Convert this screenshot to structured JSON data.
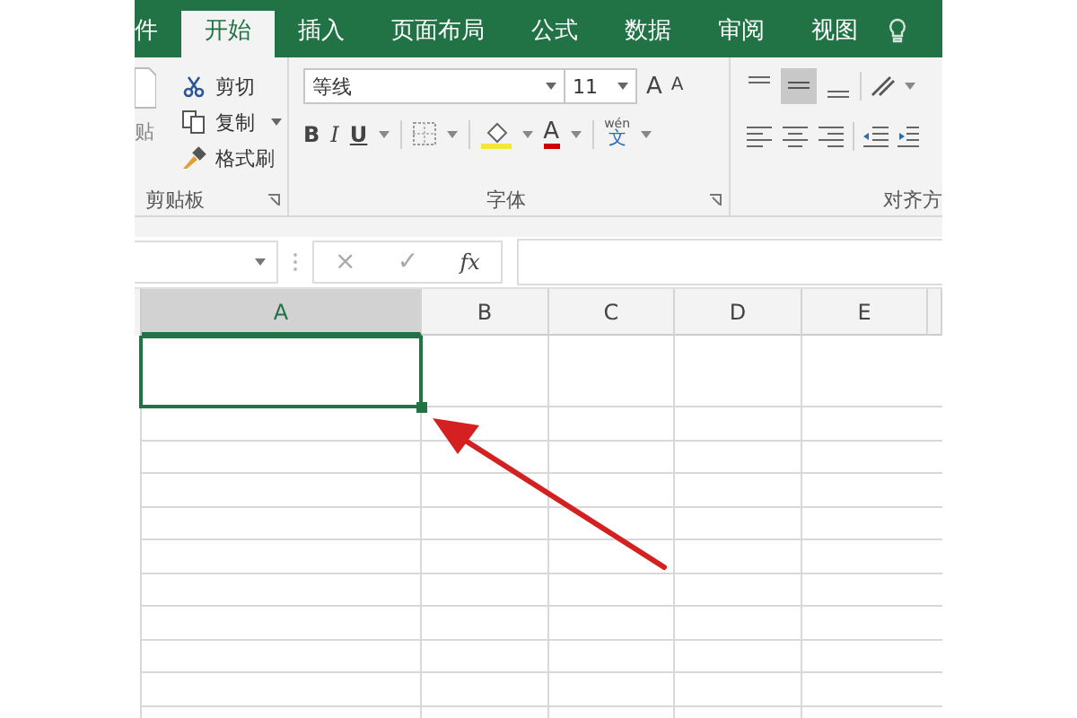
{
  "tabs": [
    {
      "label": "件",
      "selected": false
    },
    {
      "label": "开始",
      "selected": true
    },
    {
      "label": "插入",
      "selected": false
    },
    {
      "label": "页面布局",
      "selected": false
    },
    {
      "label": "公式",
      "selected": false
    },
    {
      "label": "数据",
      "selected": false
    },
    {
      "label": "审阅",
      "selected": false
    },
    {
      "label": "视图",
      "selected": false
    }
  ],
  "clipboard": {
    "paste_label": "贴",
    "items": [
      {
        "kind": "cut",
        "label": "剪切"
      },
      {
        "kind": "copy",
        "label": "复制"
      },
      {
        "kind": "painter",
        "label": "格式刷"
      }
    ],
    "group_label": "剪贴板"
  },
  "font": {
    "name": "等线",
    "size": "11",
    "grow": "A",
    "shrink": "A",
    "bold": "B",
    "italic": "I",
    "underline": "U",
    "color_letter": "A",
    "phonetic": "wén",
    "phonetic_char": "文",
    "group_label": "字体"
  },
  "alignment": {
    "group_label": "对齐方"
  },
  "formula_bar": {
    "cancel": "×",
    "enter": "✓",
    "fx": "fx"
  },
  "columns": [
    {
      "label": "A",
      "selected": true
    },
    {
      "label": "B",
      "selected": false
    },
    {
      "label": "C",
      "selected": false
    },
    {
      "label": "D",
      "selected": false
    },
    {
      "label": "E",
      "selected": false
    }
  ]
}
